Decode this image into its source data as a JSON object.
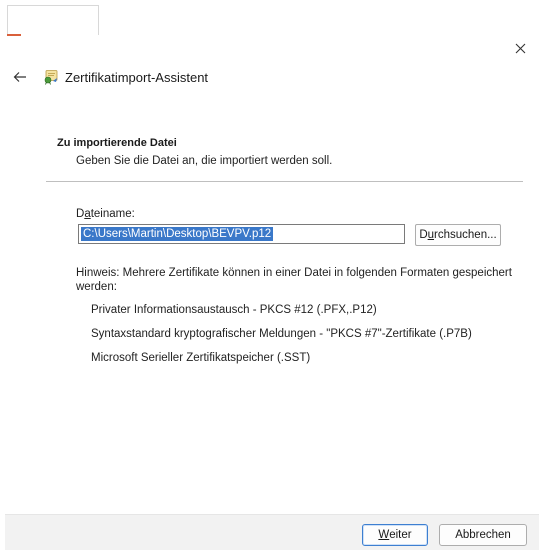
{
  "window": {
    "title": "Zertifikatimport-Assistent",
    "colors": {
      "accent": "#3a78c9",
      "footer_bg": "#f2f2f2",
      "title_accent": "#d9603b"
    }
  },
  "icons": {
    "close": "close-icon",
    "back": "arrow-left-icon",
    "wizard": "certificate-wizard-icon"
  },
  "section": {
    "heading": "Zu importierende Datei",
    "subtitle": "Geben Sie die Datei an, die importiert werden soll."
  },
  "file": {
    "label_prefix": "D",
    "label_accel": "a",
    "label_suffix": "teiname:",
    "value": "C:\\Users\\Martin\\Desktop\\BEVPV.p12",
    "browse_prefix": "D",
    "browse_accel": "u",
    "browse_suffix": "rchsuchen..."
  },
  "hint": {
    "text": "Hinweis: Mehrere Zertifikate können in einer Datei in folgenden Formaten gespeichert werden:",
    "formats": [
      "Privater Informationsaustausch - PKCS #12 (.PFX,.P12)",
      "Syntaxstandard kryptografischer Meldungen - \"PKCS #7\"-Zertifikate (.P7B)",
      "Microsoft Serieller Zertifikatspeicher (.SST)"
    ]
  },
  "footer": {
    "next_accel": "W",
    "next_suffix": "eiter",
    "cancel": "Abbrechen"
  }
}
